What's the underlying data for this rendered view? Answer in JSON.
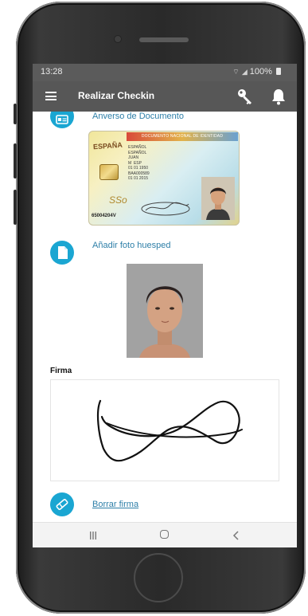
{
  "status_bar": {
    "time": "13:28",
    "indicators": "100%",
    "icons": [
      "wifi-icon",
      "signal-icon",
      "battery-icon"
    ]
  },
  "app_bar": {
    "title": "Realizar Checkin",
    "icons": [
      "menu-icon",
      "key-icon",
      "bell-icon"
    ]
  },
  "sections": {
    "document_front": {
      "label": "Anverso de Documento",
      "icon": "id-card-icon"
    },
    "id_card": {
      "header": "DOCUMENTO NACIONAL DE IDENTIDAD",
      "country": "ESPAÑA",
      "fields": [
        "ESPAÑOL",
        "ESPAÑOL",
        "JUAN",
        "M",
        "ESP",
        "01 01 1950",
        "BAA000589",
        "01 01 2015"
      ],
      "mark": "SSo",
      "number": "65004204V"
    },
    "guest_photo": {
      "label": "Añadir foto huesped",
      "icon": "document-icon"
    },
    "signature": {
      "label": "Firma"
    },
    "clear_signature": {
      "label": "Borrar firma",
      "icon": "eraser-icon"
    }
  },
  "nav_bar": {
    "icons": [
      "recents-icon",
      "home-icon",
      "back-icon"
    ]
  },
  "colors": {
    "accent": "#1aa6d2",
    "link": "#2e7fa8",
    "app_bar": "#575757",
    "status_bar": "#5b5b5b"
  }
}
